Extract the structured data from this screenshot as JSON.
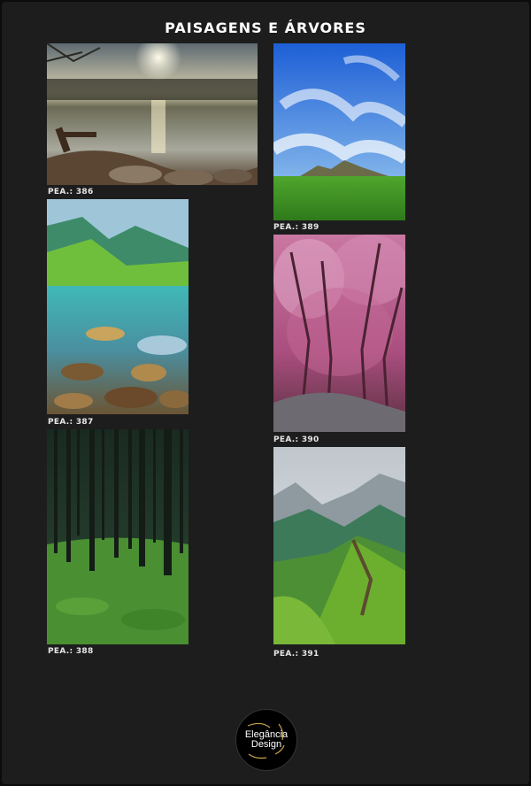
{
  "title": "PAISAGENS E ÁRVORES",
  "items": [
    {
      "code": "PEA.: 386",
      "subject": "lake-sunset-bench"
    },
    {
      "code": "PEA.: 387",
      "subject": "mountain-lake-stones"
    },
    {
      "code": "PEA.: 388",
      "subject": "pine-forest-moss"
    },
    {
      "code": "PEA.: 389",
      "subject": "blue-sky-green-field"
    },
    {
      "code": "PEA.: 390",
      "subject": "pink-tree-forest"
    },
    {
      "code": "PEA.: 391",
      "subject": "green-mountain-ridge"
    }
  ],
  "logo": {
    "line1": "Elegância",
    "line2": "Design"
  }
}
